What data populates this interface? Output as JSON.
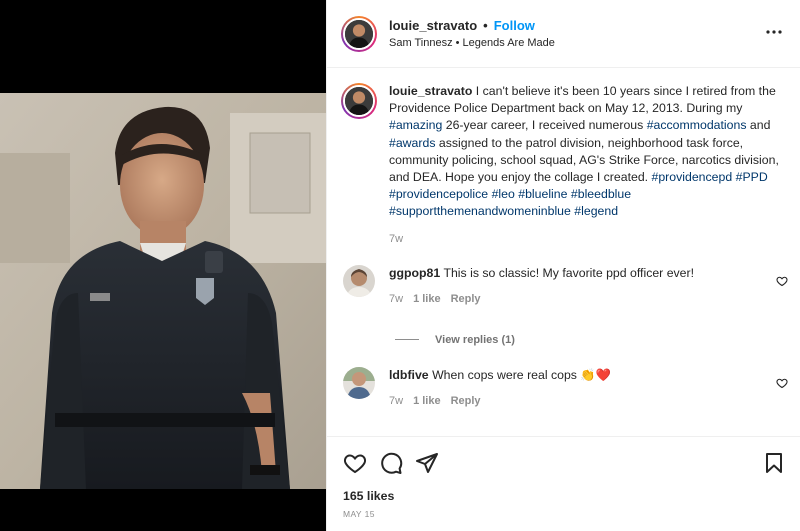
{
  "header": {
    "username": "louie_stravato",
    "separator": "•",
    "follow_label": "Follow",
    "audio": "Sam Tinnesz • Legends Are Made",
    "more_icon": "more-horizontal-icon"
  },
  "caption": {
    "username": "louie_stravato",
    "text_1": " I can't believe it's been 10 years since I retired from the Providence Police Department back on May 12, 2013. During my ",
    "tag_amazing": "#amazing",
    "text_2": " 26-year career, I received numerous ",
    "tag_accommodations": "#accommodations",
    "text_3": " and ",
    "tag_awards": "#awards",
    "text_4": " assigned to the patrol division, neighborhood task force, community policing, school squad, AG's Strike Force, narcotics division, and DEA. Hope you enjoy the collage I created. ",
    "tags_end": [
      "#providencepd",
      "#PPD",
      "#providencepolice",
      "#leo",
      "#blueline",
      "#bleedblue",
      "#supportthemenandwomeninblue",
      "#legend"
    ],
    "age": "7w"
  },
  "comments": [
    {
      "username": "ggpop81",
      "text": "This is so classic! My favorite ppd officer ever!",
      "age": "7w",
      "likes": "1 like",
      "reply": "Reply"
    },
    {
      "username": "ldbfive",
      "text": "When cops were real cops 👏❤️",
      "age": "7w",
      "likes": "1 like",
      "reply": "Reply"
    }
  ],
  "view_replies": "View replies (1)",
  "footer": {
    "like_icon": "heart-icon",
    "comment_icon": "comment-icon",
    "share_icon": "share-icon",
    "save_icon": "bookmark-icon",
    "likes": "165 likes",
    "date": "MAY 15"
  },
  "colors": {
    "link": "#0095f6",
    "hashtag": "#00376b",
    "muted": "#8e8e8e"
  }
}
